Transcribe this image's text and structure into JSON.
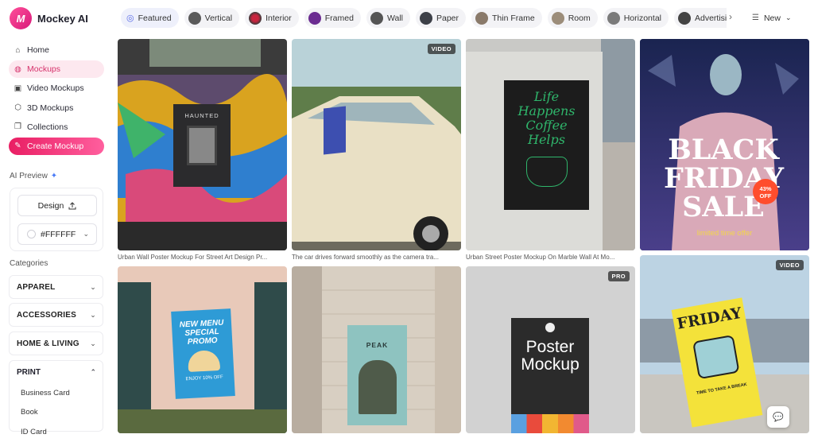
{
  "app": {
    "name": "Mockey AI",
    "logo_glyph": "M"
  },
  "nav": {
    "home": "Home",
    "mockups": "Mockups",
    "video_mockups": "Video Mockups",
    "mockups_3d": "3D Mockups",
    "collections": "Collections",
    "create": "Create Mockup"
  },
  "ai_preview": {
    "label": "AI Preview",
    "design_button": "Design",
    "color_value": "#FFFFFF"
  },
  "categories": {
    "label": "Categories",
    "apparel": "APPAREL",
    "accessories": "ACCESSORIES",
    "home_living": "HOME & LIVING",
    "print": "PRINT",
    "print_items": [
      "Business Card",
      "Book",
      "ID Card"
    ]
  },
  "filters": [
    "Featured",
    "Vertical",
    "Interior",
    "Framed",
    "Wall",
    "Paper",
    "Thin Frame",
    "Room",
    "Horizontal",
    "Advertising"
  ],
  "sort": {
    "label": "New"
  },
  "cards": [
    {
      "caption": "Urban Wall Poster Mockup For Street Art Design Pr...",
      "badge": "",
      "poster_title": "HAUNTED"
    },
    {
      "caption": "The car drives forward smoothly as the camera tra...",
      "badge": "VIDEO",
      "poster_title": ""
    },
    {
      "caption": "Urban Street Poster Mockup On Marble Wall At Mo...",
      "badge": "",
      "poster_title": "Life Happens Coffee Helps"
    },
    {
      "caption": "",
      "badge": "",
      "poster_title": "BLACK FRIDAY SALE",
      "poster_sub": "limited time offer",
      "discount": "43% OFF"
    },
    {
      "caption": "",
      "badge": "",
      "poster_title": "NEW MENU SPECIAL PROMO",
      "poster_sub": "ENJOY 10% OFF"
    },
    {
      "caption": "",
      "badge": "",
      "poster_title": "PEAK"
    },
    {
      "caption": "",
      "badge": "PRO",
      "poster_title": "Poster Mockup"
    },
    {
      "caption": "",
      "badge": "VIDEO",
      "poster_title": "FRIDAY",
      "poster_sub": "TIME TO TAKE A BREAK"
    }
  ]
}
